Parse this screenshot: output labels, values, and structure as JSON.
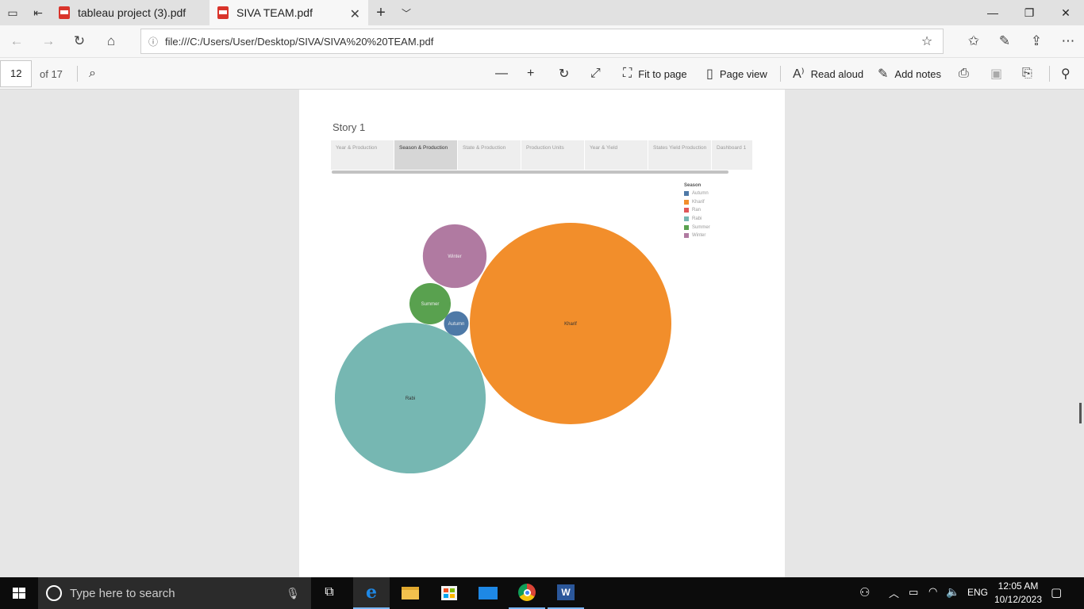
{
  "browser": {
    "tabs": [
      {
        "title": "tableau project (3).pdf",
        "active": false
      },
      {
        "title": "SIVA TEAM.pdf",
        "active": true
      }
    ],
    "url": "file:///C:/Users/User/Desktop/SIVA/SIVA%20%20TEAM.pdf"
  },
  "pdf_toolbar": {
    "page_number": "12",
    "page_total": "of 17",
    "fit_to_page": "Fit to page",
    "page_view": "Page view",
    "read_aloud": "Read aloud",
    "add_notes": "Add notes"
  },
  "story": {
    "title": "Story 1",
    "tabs": [
      "Year & Production",
      "Season & Production",
      "State & Production",
      "Production Units",
      "Year & Yield",
      "States Yield Production",
      "Dashboard 1"
    ],
    "active_tab": 1
  },
  "chart_data": {
    "type": "packed-bubble",
    "legend_title": "Season",
    "legend": [
      {
        "name": "Autumn",
        "color": "#4e79a7"
      },
      {
        "name": "Kharif",
        "color": "#f28e2b"
      },
      {
        "name": "Ran",
        "color": "#e15759"
      },
      {
        "name": "Rabi",
        "color": "#76b7b2"
      },
      {
        "name": "Summer",
        "color": "#59a14f"
      },
      {
        "name": "Winter",
        "color": "#b07aa1"
      }
    ],
    "bubbles": [
      {
        "label": "Kharif",
        "relative_size": 1.0,
        "color": "#f28e2b"
      },
      {
        "label": "Rabi",
        "relative_size": 0.56,
        "color": "#76b7b2"
      },
      {
        "label": "Winter",
        "relative_size": 0.1,
        "color": "#b07aa1"
      },
      {
        "label": "Summer",
        "relative_size": 0.042,
        "color": "#59a14f"
      },
      {
        "label": "Autumn",
        "relative_size": 0.015,
        "color": "#4e79a7"
      }
    ]
  },
  "taskbar": {
    "search_placeholder": "Type here to search",
    "language": "ENG",
    "time": "12:05 AM",
    "date": "10/12/2023"
  }
}
